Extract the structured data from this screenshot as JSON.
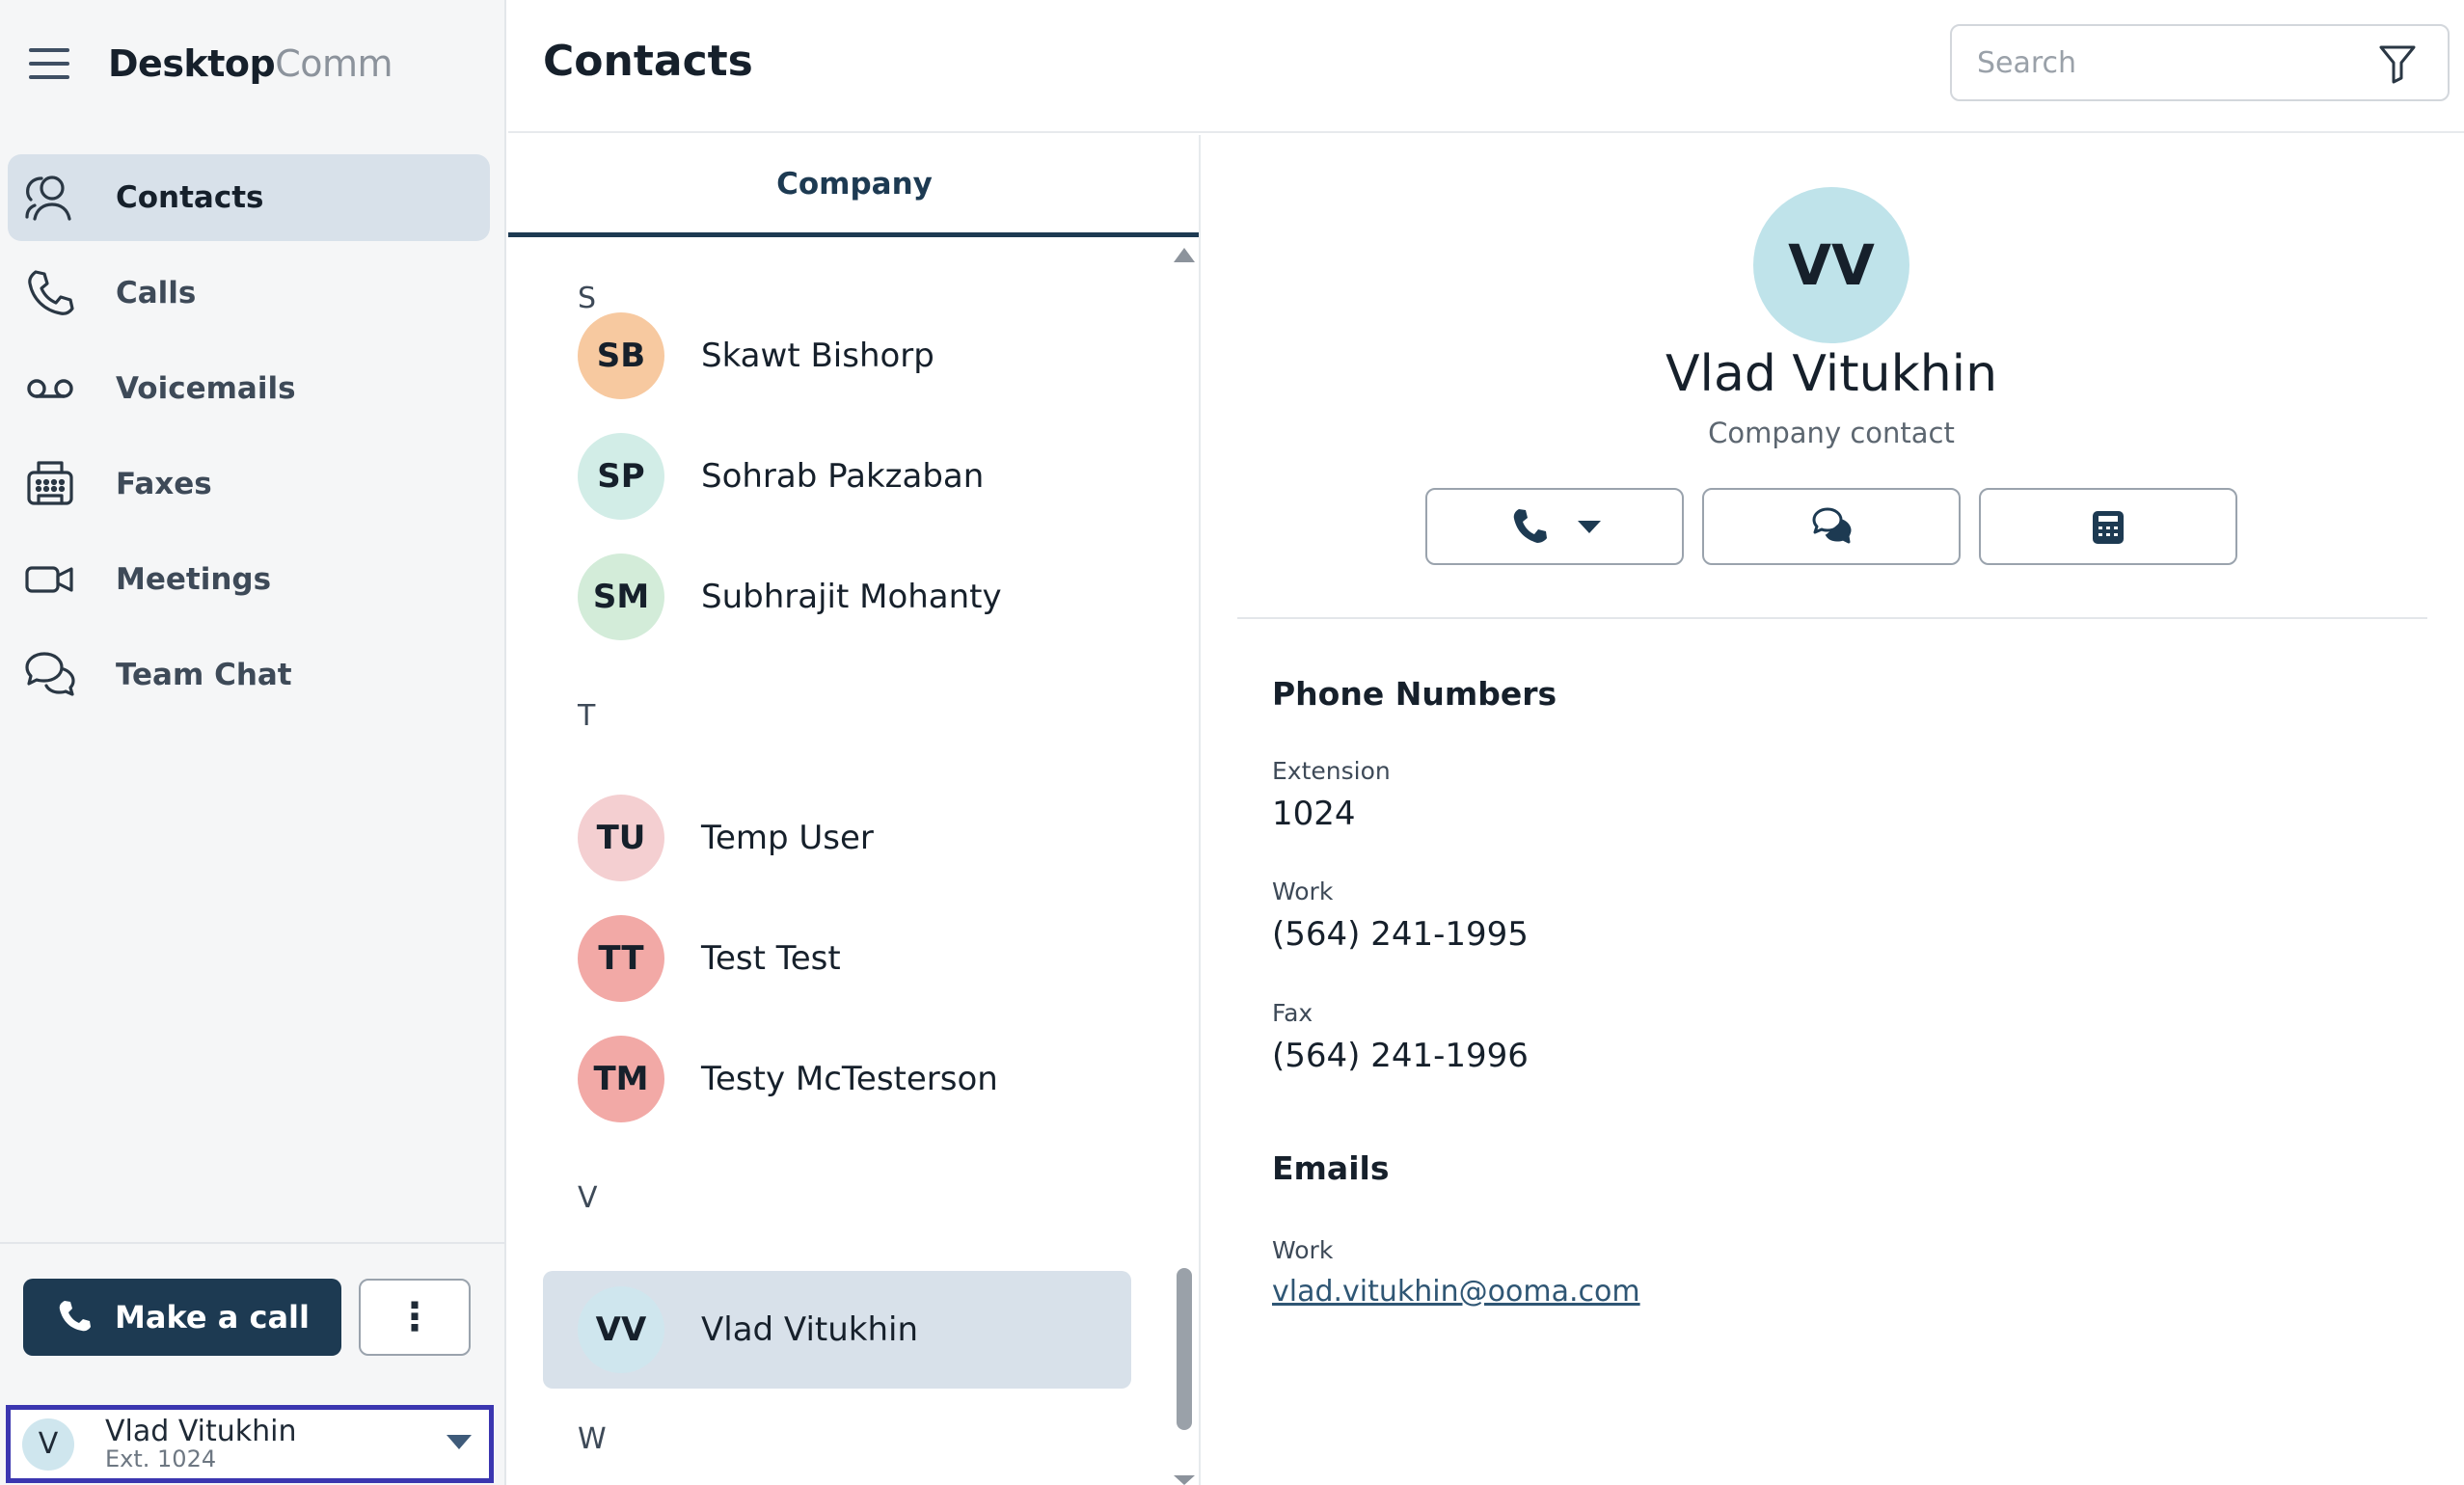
{
  "brand": {
    "name_bold": "Desktop",
    "name_light": "Comm"
  },
  "sidebar": {
    "items": [
      {
        "label": "Contacts",
        "icon": "contacts-icon",
        "active": true
      },
      {
        "label": "Calls",
        "icon": "phone-icon"
      },
      {
        "label": "Voicemails",
        "icon": "voicemail-icon"
      },
      {
        "label": "Faxes",
        "icon": "fax-icon"
      },
      {
        "label": "Meetings",
        "icon": "video-camera-icon"
      },
      {
        "label": "Team Chat",
        "icon": "chat-bubbles-icon"
      }
    ],
    "make_call_label": "Make a call",
    "more_label": "⋮",
    "user": {
      "initial": "V",
      "name": "Vlad Vitukhin",
      "ext": "Ext. 1024"
    }
  },
  "header": {
    "title": "Contacts",
    "search_placeholder": "Search"
  },
  "list": {
    "tab_label": "Company",
    "letters": {
      "s": "S",
      "t": "T",
      "v": "V",
      "w": "W"
    },
    "contacts": [
      {
        "initials": "SB",
        "name": "Skawt Bishorp",
        "color": "#f7c9a0"
      },
      {
        "initials": "SP",
        "name": "Sohrab Pakzaban",
        "color": "#d2ede7"
      },
      {
        "initials": "SM",
        "name": "Subhrajit Mohanty",
        "color": "#d3ecd9"
      },
      {
        "initials": "TU",
        "name": "Temp User",
        "color": "#f4cfd1"
      },
      {
        "initials": "TT",
        "name": "Test Test",
        "color": "#f2a9a6"
      },
      {
        "initials": "TM",
        "name": "Testy McTesterson",
        "color": "#f2a9a6"
      },
      {
        "initials": "VV",
        "name": "Vlad Vitukhin",
        "color": "#cfe6ee",
        "selected": true
      }
    ]
  },
  "detail": {
    "initials": "VV",
    "name": "Vlad Vitukhin",
    "subtitle": "Company contact",
    "phone_section_title": "Phone Numbers",
    "extension_label": "Extension",
    "extension_value": "1024",
    "work_label": "Work",
    "work_value": "(564) 241-1995",
    "fax_label": "Fax",
    "fax_value": "(564) 241-1996",
    "emails_section_title": "Emails",
    "email_label": "Work",
    "email_value": "vlad.vitukhin@ooma.com"
  },
  "colors": {
    "accent": "#1d3a52",
    "active_bg": "#d8e1ea",
    "focus_outline": "#3b36b0"
  }
}
